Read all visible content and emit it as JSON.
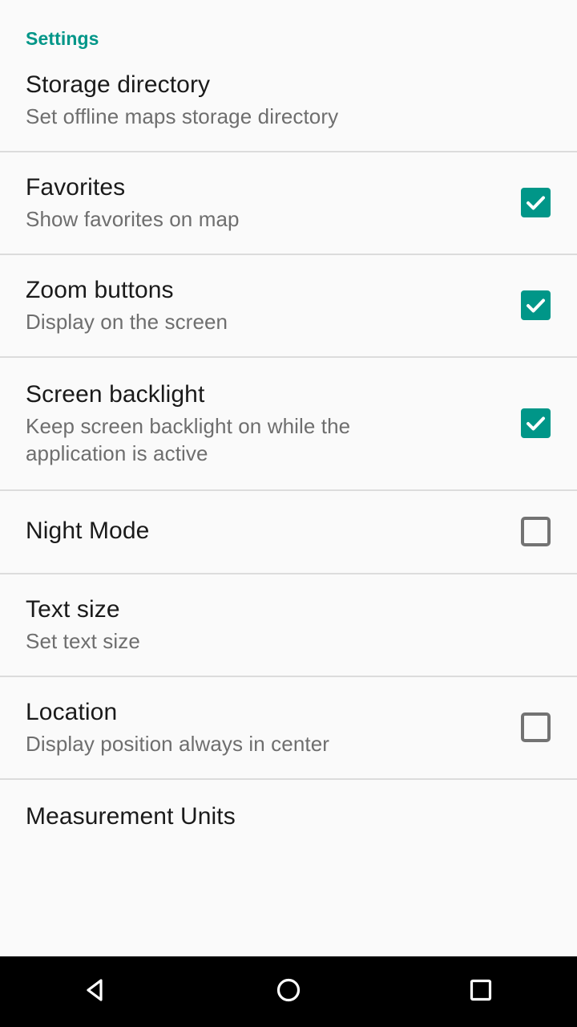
{
  "screen": {
    "background_color": "#fafafa",
    "accent_color": "#009688",
    "title_color": "#1a1a1a",
    "summary_color": "#6e6e6e",
    "divider_color": "#dcdcdc"
  },
  "section": {
    "header": "Settings"
  },
  "preferences": [
    {
      "title": "Storage directory",
      "summary": "Set offline maps storage directory",
      "control": "none"
    },
    {
      "title": "Favorites",
      "summary": "Show favorites on map",
      "control": "checkbox",
      "checked": true
    },
    {
      "title": "Zoom buttons",
      "summary": "Display on the screen",
      "control": "checkbox",
      "checked": true
    },
    {
      "title": "Screen backlight",
      "summary": "Keep screen backlight on while the application is active",
      "control": "checkbox",
      "checked": true
    },
    {
      "title": "Night Mode",
      "summary": "",
      "control": "checkbox",
      "checked": false
    },
    {
      "title": "Text size",
      "summary": "Set text size",
      "control": "none"
    },
    {
      "title": "Location",
      "summary": "Display position always in center",
      "control": "checkbox",
      "checked": false
    },
    {
      "title": "Measurement Units",
      "summary": "",
      "control": "none"
    }
  ],
  "navbar": {
    "background_color": "#000000",
    "buttons": [
      {
        "name": "back",
        "icon": "back-triangle-icon"
      },
      {
        "name": "home",
        "icon": "home-circle-icon"
      },
      {
        "name": "recents",
        "icon": "recents-square-icon"
      }
    ]
  }
}
